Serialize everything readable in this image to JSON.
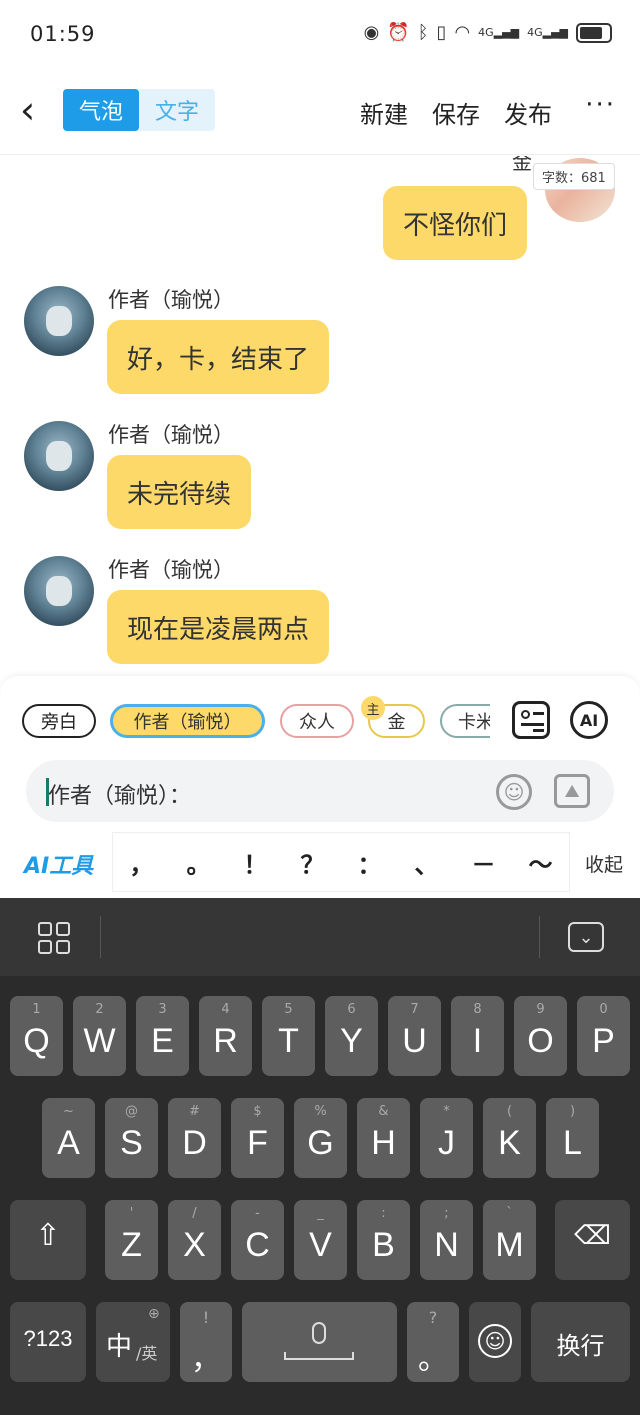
{
  "status": {
    "time": "01:59",
    "signal1": "4G",
    "signal2": "4G"
  },
  "header": {
    "tab_bubble": "气泡",
    "tab_text": "文字",
    "new": "新建",
    "save": "保存",
    "publish": "发布",
    "more": "···"
  },
  "chat": {
    "top_name": "金",
    "char_count": "字数：681",
    "right_message": "不怪你们",
    "messages": [
      {
        "name": "作者（瑜悦）",
        "text": "好，卡，结束了"
      },
      {
        "name": "作者（瑜悦）",
        "text": "未完待续"
      },
      {
        "name": "作者（瑜悦）",
        "text": "现在是凌晨两点"
      }
    ]
  },
  "panel": {
    "roles": [
      "旁白",
      "作者（瑜悦）",
      "众人",
      "金",
      "卡米"
    ],
    "main_badge": "主",
    "ai_label": "AI",
    "input_value": "作者（瑜悦）：",
    "ai_tools": "AI工具",
    "punctuation": [
      "，",
      "。",
      "！",
      "？",
      "：",
      "、",
      "－",
      "～"
    ],
    "collapse": "收起"
  },
  "keyboard": {
    "row1": [
      [
        "1",
        "Q"
      ],
      [
        "2",
        "W"
      ],
      [
        "3",
        "E"
      ],
      [
        "4",
        "R"
      ],
      [
        "5",
        "T"
      ],
      [
        "6",
        "Y"
      ],
      [
        "7",
        "U"
      ],
      [
        "8",
        "I"
      ],
      [
        "9",
        "O"
      ],
      [
        "0",
        "P"
      ]
    ],
    "row2": [
      [
        "~",
        "A"
      ],
      [
        "@",
        "S"
      ],
      [
        "#",
        "D"
      ],
      [
        "$",
        "F"
      ],
      [
        "%",
        "G"
      ],
      [
        "&",
        "H"
      ],
      [
        "*",
        "J"
      ],
      [
        "(",
        "K"
      ],
      [
        ")",
        "L"
      ]
    ],
    "row3": [
      [
        "'",
        "Z"
      ],
      [
        "/",
        "X"
      ],
      [
        "-",
        "C"
      ],
      [
        "_",
        "V"
      ],
      [
        ":",
        "B"
      ],
      [
        ";",
        "N"
      ],
      [
        "`",
        "M"
      ]
    ],
    "num": "?123",
    "lang_main": "中",
    "lang_sub": "/英",
    "comma_sub": "!",
    "comma": "，",
    "period_sub": "?",
    "period": "。",
    "enter": "换行"
  }
}
